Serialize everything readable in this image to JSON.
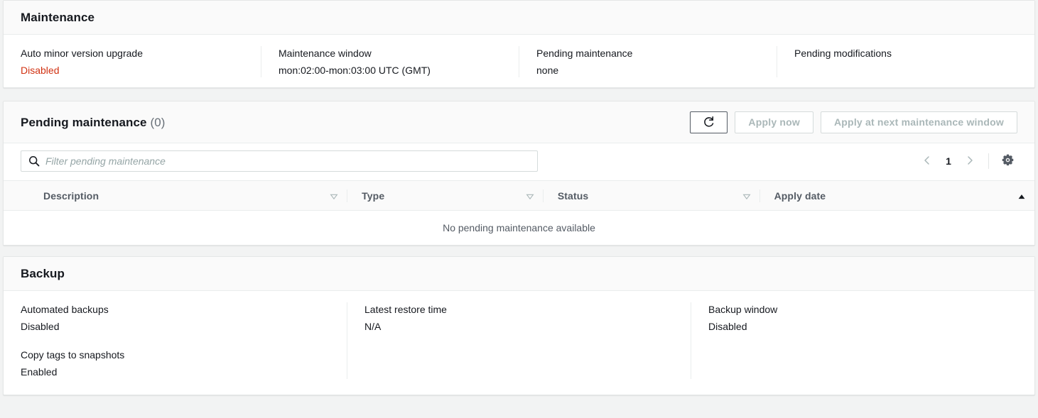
{
  "maintenance_panel": {
    "title": "Maintenance",
    "attributes": [
      {
        "label": "Auto minor version upgrade",
        "value": "Disabled",
        "value_state": "danger"
      },
      {
        "label": "Maintenance window",
        "value": "mon:02:00-mon:03:00 UTC (GMT)",
        "value_state": "normal"
      },
      {
        "label": "Pending maintenance",
        "value": "none",
        "value_state": "normal"
      },
      {
        "label": "Pending modifications",
        "value": "",
        "value_state": "normal"
      }
    ]
  },
  "pending_panel": {
    "title": "Pending maintenance",
    "counter": "(0)",
    "refresh_icon": "refresh-icon",
    "buttons": [
      {
        "label": "Apply now",
        "state": "disabled"
      },
      {
        "label": "Apply at next maintenance window",
        "state": "disabled"
      }
    ],
    "filter": {
      "icon": "search-icon",
      "placeholder": "Filter pending maintenance",
      "value": ""
    },
    "pagination": {
      "prev_icon": "chevron-left-icon",
      "page": "1",
      "next_icon": "chevron-right-icon",
      "settings_icon": "gear-icon"
    },
    "table": {
      "columns": [
        {
          "label": "Description",
          "sort": "sortable",
          "sort_icon": "caret-down-outline-icon"
        },
        {
          "label": "Type",
          "sort": "sortable",
          "sort_icon": "caret-down-outline-icon"
        },
        {
          "label": "Status",
          "sort": "sortable",
          "sort_icon": "caret-down-outline-icon"
        },
        {
          "label": "Apply date",
          "sort": "ascending",
          "sort_icon": "caret-up-filled-icon"
        }
      ],
      "rows": [],
      "empty_message": "No pending maintenance available"
    }
  },
  "backup_panel": {
    "title": "Backup",
    "columns": [
      {
        "blocks": [
          {
            "label": "Automated backups",
            "value": "Disabled"
          },
          {
            "label": "Copy tags to snapshots",
            "value": "Enabled"
          }
        ]
      },
      {
        "blocks": [
          {
            "label": "Latest restore time",
            "value": "N/A"
          }
        ]
      },
      {
        "blocks": [
          {
            "label": "Backup window",
            "value": "Disabled"
          }
        ]
      }
    ]
  },
  "colors": {
    "danger": "#d13212",
    "text": "#16191f",
    "muted": "#545b64",
    "disabled": "#aab7b8",
    "border": "#eaeded",
    "panel_header_bg": "#fafafa",
    "page_bg": "#f2f3f3"
  }
}
